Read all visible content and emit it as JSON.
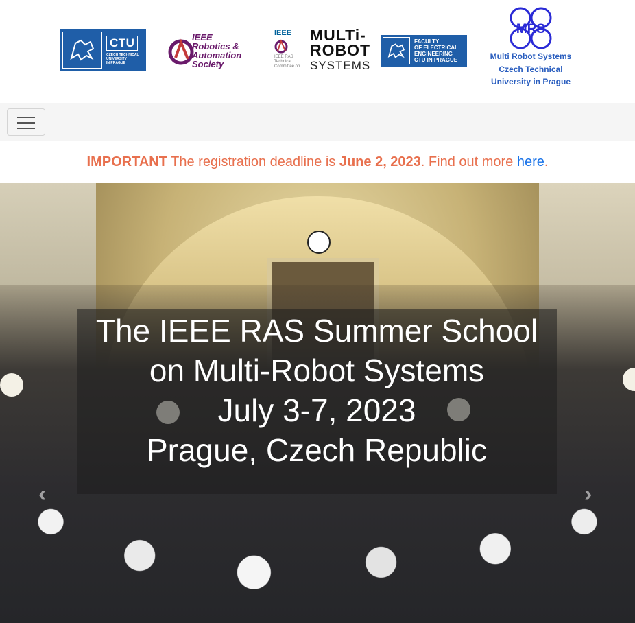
{
  "logos": {
    "ctu": {
      "big": "CTU",
      "small": "CZECH TECHNICAL\nUNIVERSITY\nIN PRAGUE"
    },
    "ieee_ras": {
      "text": "IEEE\nRobotics &\nAutomation\nSociety"
    },
    "mrs_tc": {
      "ieee": "IEEE",
      "small": "IEEE RAS\nTechnical\nCommittee on",
      "multi": "MULTi-\nROBOT",
      "systems": "SYSTEMS"
    },
    "fee": {
      "text": "FACULTY\nOF ELECTRICAL\nENGINEERING\nCTU IN PRAGUE"
    },
    "mrs": {
      "mark": "MRS",
      "line1": "Multi Robot Systems",
      "line2": "Czech Technical",
      "line3": "University in Prague"
    }
  },
  "navbar": {
    "toggler_icon": "hamburger-icon"
  },
  "announcement": {
    "important": "IMPORTANT",
    "text1": " The registration deadline is ",
    "date": "June 2, 2023",
    "text2": ". Find out more ",
    "link": "here",
    "end": "."
  },
  "hero": {
    "line1": "The IEEE RAS Summer School",
    "line2": "on Multi-Robot Systems",
    "line3": "July 3-7, 2023",
    "line4": "Prague, Czech Republic",
    "prev_icon": "chevron-left-icon",
    "next_icon": "chevron-right-icon",
    "prev_glyph": "‹",
    "next_glyph": "›"
  },
  "colors": {
    "announce": "#e8704e",
    "link": "#1a73e8",
    "ctu_blue": "#1f5ea8",
    "mrs_blue": "#2a5ebf"
  }
}
